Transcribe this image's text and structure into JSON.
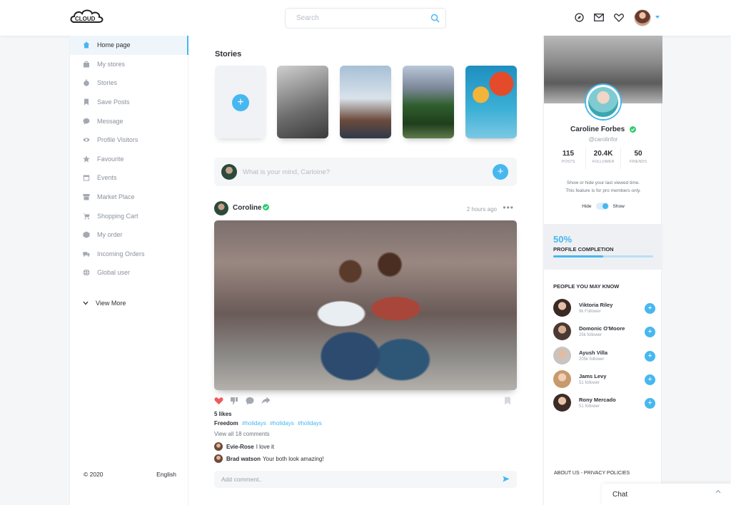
{
  "header": {
    "logo_text": "CLOUD",
    "search_placeholder": "Search"
  },
  "sidebar": {
    "items": [
      {
        "label": "Home page"
      },
      {
        "label": "My stores"
      },
      {
        "label": "Stories"
      },
      {
        "label": "Save Posts"
      },
      {
        "label": "Message"
      },
      {
        "label": "Profile Visitors"
      },
      {
        "label": "Favourite"
      },
      {
        "label": "Events"
      },
      {
        "label": "Market Place"
      },
      {
        "label": "Shopping Cart"
      },
      {
        "label": "My order"
      },
      {
        "label": "Incoming Orders"
      },
      {
        "label": "Global user"
      }
    ],
    "view_more": "View More",
    "footer_copyright": "© 2020",
    "footer_language": "English"
  },
  "feed": {
    "stories_title": "Stories",
    "composer_placeholder": "What is your mind, Carloine?",
    "post": {
      "author": "Coroline",
      "time": "2 hours ago",
      "likes": "5 likes",
      "caption_title": "Freedom",
      "hashtags": [
        "#holidays",
        "#holidays",
        "#holidays"
      ],
      "view_comments": "View all 18 comments",
      "comments": [
        {
          "author": "Evie-Rose",
          "text": "I love it"
        },
        {
          "author": "Brad watson",
          "text": "Your both look amazing!"
        }
      ],
      "add_comment_placeholder": "Add comment.."
    }
  },
  "profile": {
    "name": "Caroline Forbes",
    "handle": "@carolinfor",
    "stats": [
      {
        "value": "115",
        "label": "POSTS"
      },
      {
        "value": "20.4K",
        "label": "FOLLOWER"
      },
      {
        "value": "50",
        "label": "FRIENDS"
      }
    ],
    "note_line1": "Show or hide your last viewed time.",
    "note_line2": "This feature is for pro members only.",
    "toggle_hide": "Hide",
    "toggle_show": "Show",
    "completion_percent": "50%",
    "completion_fraction": 0.5,
    "completion_label": "PROFILE COMPLETION"
  },
  "people": {
    "title": "PEOPLE YOU MAY KNOW",
    "list": [
      {
        "name": "Viktoria Riley",
        "followers": "9k Follower"
      },
      {
        "name": "Domonic O'Moore",
        "followers": "25k follower"
      },
      {
        "name": "Ayush Villa",
        "followers": "205k follower"
      },
      {
        "name": "Jams Levy",
        "followers": "51 follower"
      },
      {
        "name": "Rony Mercado",
        "followers": "51 follower"
      }
    ]
  },
  "footer_links": {
    "about": "ABOUT US",
    "separator": "-",
    "privacy": "PRIVACY POLICIES"
  },
  "chat": {
    "label": "Chat"
  },
  "colors": {
    "accent": "#47b7ef",
    "like": "#f05a5a",
    "verified": "#2ecc71"
  }
}
